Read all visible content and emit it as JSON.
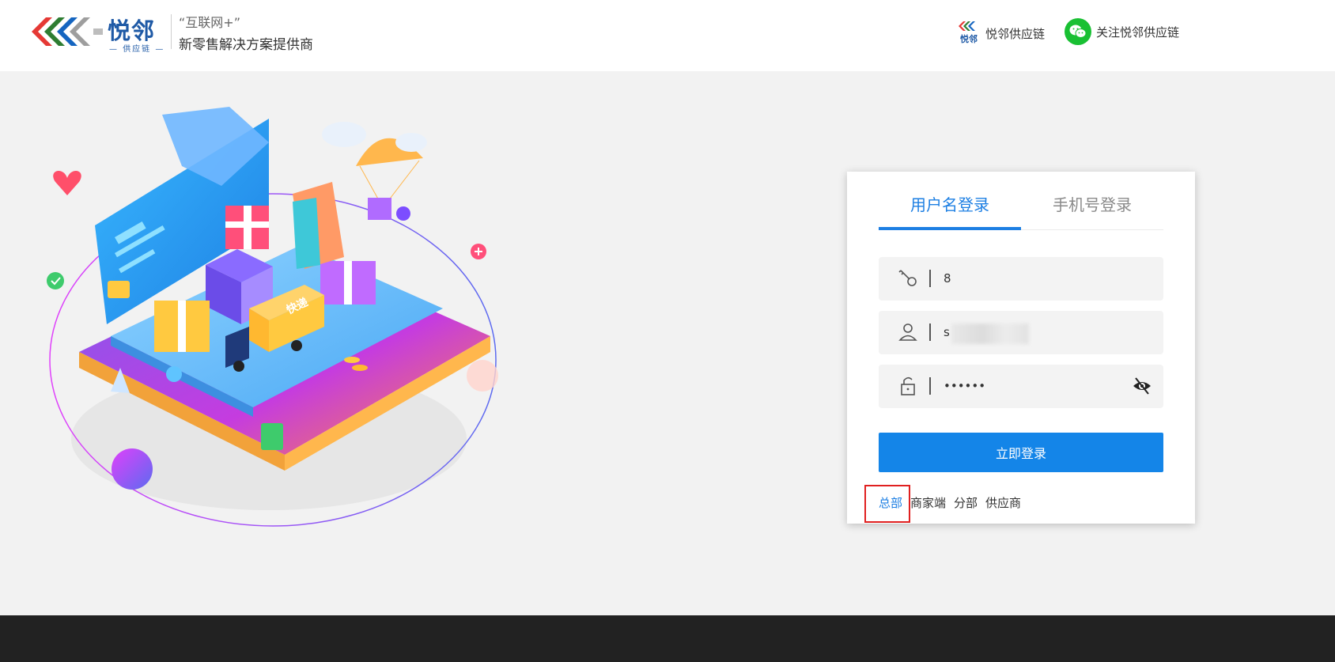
{
  "header": {
    "logo_name": "悦邻",
    "logo_sub": "供应链",
    "slogan_line1": "“互联网+”",
    "slogan_line2": "新零售解决方案提供商",
    "link_supply_chain": "悦邻供应链",
    "link_follow": "关注悦邻供应链",
    "mini_logo_text": "悦邻"
  },
  "login": {
    "tabs": [
      {
        "label": "用户名登录",
        "active": true
      },
      {
        "label": "手机号登录",
        "active": false
      }
    ],
    "fields": {
      "code_value": "8",
      "username_value": "s",
      "password_value": "••••••"
    },
    "submit_label": "立即登录",
    "roles": [
      {
        "label": "总部",
        "active": true
      },
      {
        "label": "商家端",
        "active": false
      },
      {
        "label": "分部",
        "active": false
      },
      {
        "label": "供应商",
        "active": false
      }
    ]
  },
  "illustration": {
    "truck_label": "快递"
  },
  "colors": {
    "accent": "#1d7fe3",
    "button": "#1485e8",
    "brand_blue": "#1f5aa6",
    "wechat_green": "#19c033",
    "footer": "#222222",
    "highlight": "#e02020"
  },
  "icons": [
    "key-icon",
    "user-icon",
    "lock-icon",
    "eye-slash-icon",
    "wechat-icon"
  ]
}
